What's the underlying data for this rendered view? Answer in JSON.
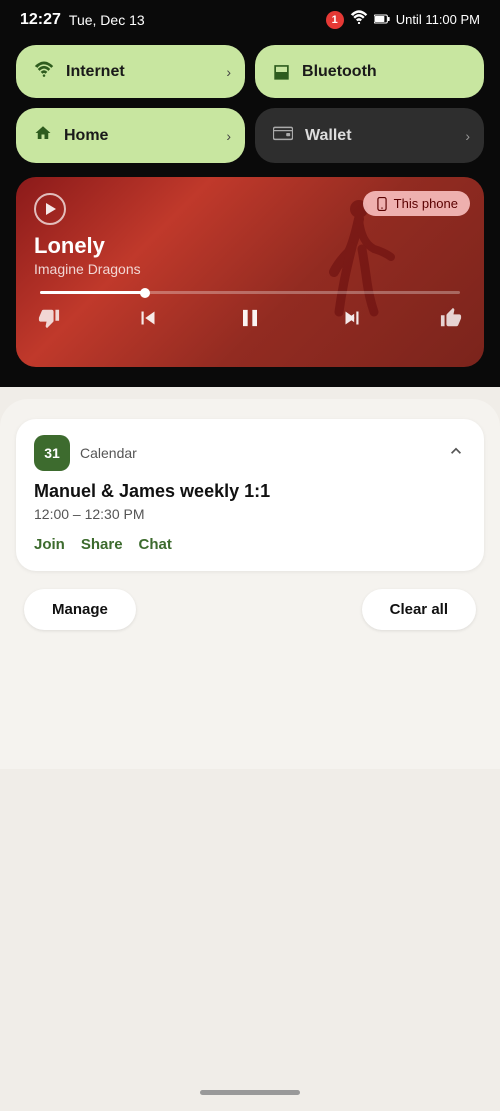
{
  "statusBar": {
    "time": "12:27",
    "date": "Tue, Dec 13",
    "notifCount": "1",
    "batteryText": "Until 11:00 PM"
  },
  "quickSettings": {
    "tiles": [
      {
        "id": "internet",
        "label": "Internet",
        "icon": "wifi",
        "active": true,
        "hasChevron": true
      },
      {
        "id": "bluetooth",
        "label": "Bluetooth",
        "icon": "bluetooth",
        "active": true,
        "hasChevron": false
      },
      {
        "id": "home",
        "label": "Home",
        "icon": "home",
        "active": true,
        "hasChevron": true
      },
      {
        "id": "wallet",
        "label": "Wallet",
        "icon": "wallet",
        "active": false,
        "hasChevron": true
      }
    ]
  },
  "musicPlayer": {
    "playIcon": "▶",
    "thisPhoneLabel": "This phone",
    "title": "Lonely",
    "artist": "Imagine Dragons",
    "progressPercent": 25
  },
  "calendar": {
    "appName": "Calendar",
    "dayNumber": "31",
    "eventTitle": "Manuel & James weekly 1:1",
    "eventTime": "12:00 – 12:30 PM",
    "actions": {
      "join": "Join",
      "share": "Share",
      "chat": "Chat"
    }
  },
  "bottomButtons": {
    "manage": "Manage",
    "clearAll": "Clear all"
  }
}
